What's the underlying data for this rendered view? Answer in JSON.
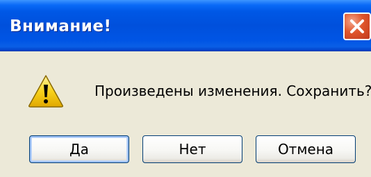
{
  "window": {
    "title": "Внимание!"
  },
  "dialog": {
    "icon": "warning-icon",
    "message": "Произведены изменения. Сохранить?"
  },
  "buttons": {
    "yes_label": "Да",
    "no_label": "Нет",
    "cancel_label": "Отмена"
  },
  "colors": {
    "titlebar": "#0055e5",
    "close_button": "#e0562c",
    "dialog_background": "#ece9d8",
    "warning_icon": "#f8d21c"
  }
}
